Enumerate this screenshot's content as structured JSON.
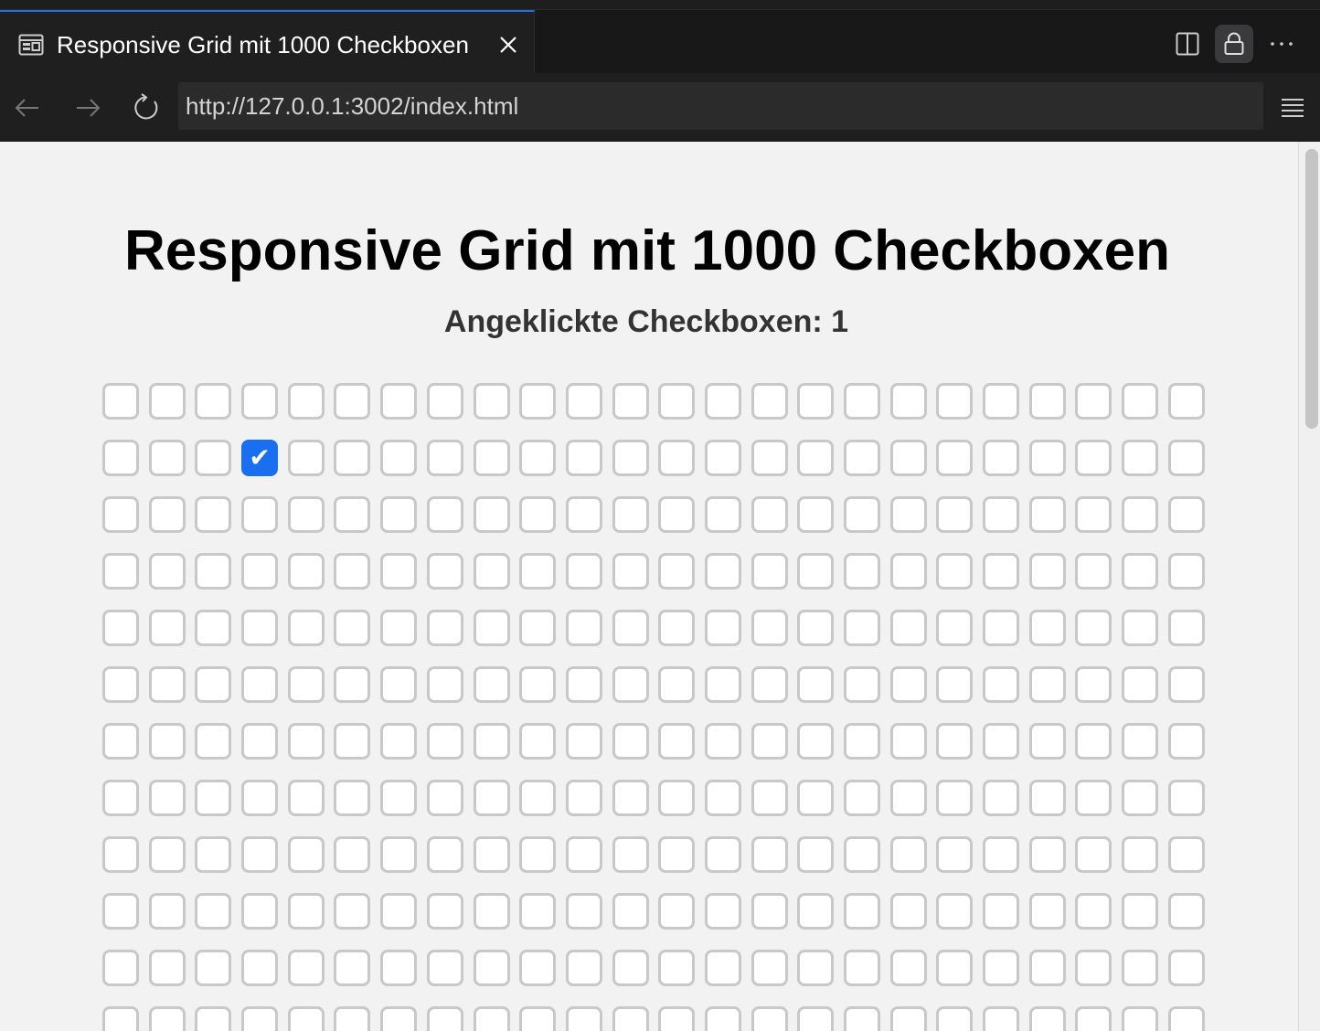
{
  "browser": {
    "tab_title": "Responsive Grid mit 1000 Checkboxen",
    "url": "http://127.0.0.1:3002/index.html",
    "icons": {
      "tab": "page-preview-icon",
      "close": "close-icon",
      "split": "split-editor-icon",
      "lock": "lock-icon",
      "more": "more-icon",
      "back": "back-arrow-icon",
      "forward": "forward-arrow-icon",
      "reload": "reload-icon",
      "menu": "menu-icon"
    },
    "accent": "#1f6feb"
  },
  "page": {
    "title": "Responsive Grid mit 1000 Checkboxen",
    "counter_label": "Angeklickte Checkboxen:",
    "counter_value": "1",
    "grid": {
      "columns": 24,
      "visible_rows": 12,
      "checked": [
        {
          "row": 2,
          "col": 4
        }
      ],
      "checked_color": "#1a6ff0"
    }
  }
}
